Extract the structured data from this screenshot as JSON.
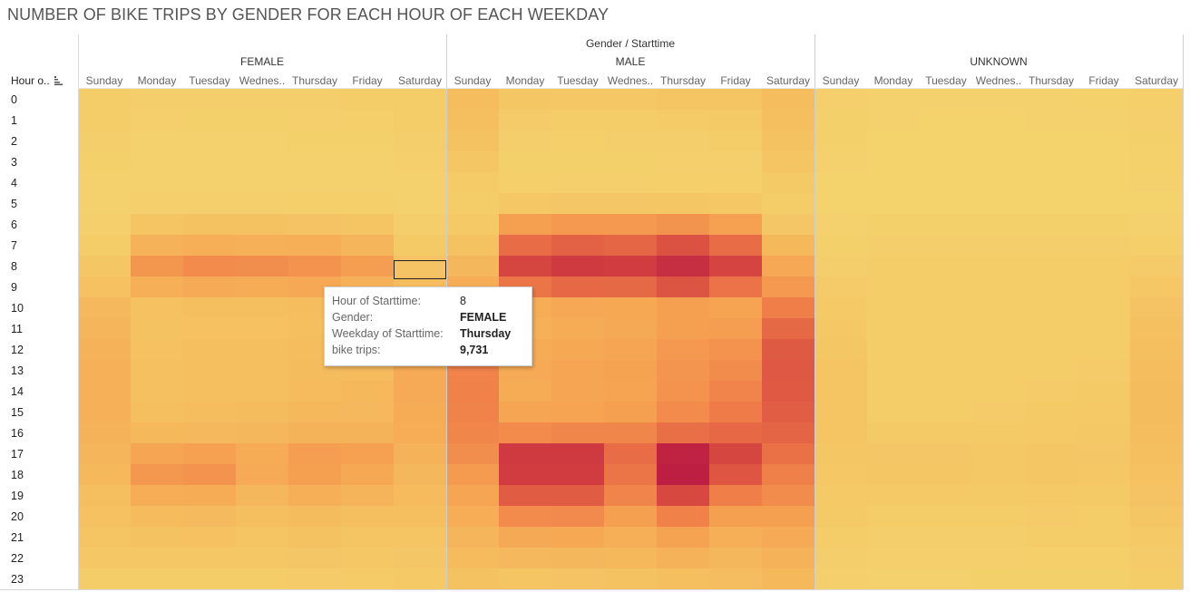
{
  "title": "NUMBER OF BIKE TRIPS BY GENDER FOR EACH HOUR OF EACH WEEKDAY",
  "header": {
    "top_label": "Gender / Starttime",
    "row_header": "Hour o..",
    "sort_icon": "sort-descending-icon"
  },
  "colors": {
    "low": "#f4d36d",
    "high": "#bc1f41",
    "grid_line": "#d9d9d9"
  },
  "tooltip": {
    "rows": [
      {
        "label": "Hour of Starttime:",
        "value": "8"
      },
      {
        "label": "Gender:",
        "value": "FEMALE"
      },
      {
        "label": "Weekday of Starttime:",
        "value": "Thursday"
      },
      {
        "label": "bike trips:",
        "value": "9,731"
      }
    ]
  },
  "chart_data": {
    "type": "heatmap",
    "title": "NUMBER OF BIKE TRIPS BY GENDER FOR EACH HOUR OF EACH WEEKDAY",
    "groups": [
      "FEMALE",
      "MALE",
      "UNKNOWN"
    ],
    "columns": [
      "Sunday",
      "Monday",
      "Tuesday",
      "Wednes..",
      "Thursday",
      "Friday",
      "Saturday"
    ],
    "rows": [
      "0",
      "1",
      "2",
      "3",
      "4",
      "5",
      "6",
      "7",
      "8",
      "9",
      "10",
      "11",
      "12",
      "13",
      "14",
      "15",
      "16",
      "17",
      "18",
      "19",
      "20",
      "21",
      "22",
      "23"
    ],
    "value_max": 20000,
    "values": {
      "FEMALE": [
        [
          1400,
          1000,
          900,
          900,
          1000,
          1100,
          1400
        ],
        [
          1200,
          700,
          600,
          600,
          700,
          800,
          1300
        ],
        [
          900,
          400,
          400,
          400,
          500,
          500,
          1000
        ],
        [
          600,
          300,
          300,
          300,
          300,
          300,
          700
        ],
        [
          400,
          300,
          300,
          300,
          300,
          300,
          400
        ],
        [
          400,
          700,
          700,
          700,
          800,
          800,
          400
        ],
        [
          700,
          2800,
          3200,
          3200,
          3000,
          2600,
          900
        ],
        [
          1300,
          6000,
          6600,
          6300,
          6500,
          5500,
          1800
        ],
        [
          2500,
          9500,
          10500,
          10200,
          9731,
          8800,
          3000
        ],
        [
          3500,
          6500,
          7200,
          7000,
          7500,
          6300,
          4200
        ],
        [
          5000,
          3500,
          4000,
          4000,
          4200,
          4000,
          5500
        ],
        [
          5500,
          3200,
          3500,
          3500,
          3800,
          4000,
          6500
        ],
        [
          6000,
          3500,
          3800,
          3800,
          4200,
          4200,
          7000
        ],
        [
          6200,
          3600,
          3900,
          3900,
          4300,
          4500,
          7200
        ],
        [
          6300,
          3600,
          3900,
          4000,
          4500,
          4800,
          7200
        ],
        [
          6200,
          3800,
          4200,
          4300,
          4800,
          5000,
          7000
        ],
        [
          6000,
          4800,
          5000,
          5200,
          5700,
          5800,
          6700
        ],
        [
          5500,
          8000,
          8400,
          7000,
          8800,
          8400,
          6000
        ],
        [
          4800,
          9400,
          9800,
          7200,
          8600,
          7600,
          5200
        ],
        [
          4000,
          6800,
          7000,
          5200,
          6400,
          5600,
          4500
        ],
        [
          3500,
          4500,
          4600,
          3900,
          4400,
          3800,
          3800
        ],
        [
          2800,
          3300,
          3400,
          2900,
          3300,
          2900,
          2900
        ],
        [
          2200,
          2200,
          2300,
          2200,
          2400,
          2200,
          2400
        ],
        [
          1400,
          1200,
          1300,
          1300,
          1500,
          1600,
          1900
        ]
      ],
      "MALE": [
        [
          4200,
          2500,
          2200,
          2200,
          2600,
          2900,
          4200
        ],
        [
          3800,
          1500,
          1300,
          1300,
          1600,
          1800,
          3800
        ],
        [
          3300,
          900,
          800,
          900,
          1000,
          1100,
          3300
        ],
        [
          2500,
          600,
          600,
          600,
          700,
          700,
          2600
        ],
        [
          1600,
          800,
          700,
          700,
          800,
          800,
          1800
        ],
        [
          1200,
          2200,
          2400,
          2400,
          2500,
          2300,
          1300
        ],
        [
          1900,
          8500,
          9200,
          9200,
          9700,
          8400,
          2400
        ],
        [
          3300,
          13200,
          14000,
          13600,
          15200,
          13200,
          4800
        ],
        [
          5200,
          16000,
          17200,
          17000,
          18500,
          16200,
          7500
        ],
        [
          6800,
          12500,
          13500,
          13400,
          15000,
          12700,
          9200
        ],
        [
          9000,
          6800,
          7500,
          7600,
          8500,
          8200,
          11800
        ],
        [
          10000,
          6300,
          7000,
          7300,
          8500,
          8800,
          13400
        ],
        [
          11000,
          7000,
          7600,
          8000,
          9200,
          9800,
          14500
        ],
        [
          11400,
          7200,
          7800,
          8300,
          9600,
          10400,
          14700
        ],
        [
          11500,
          7100,
          7800,
          8200,
          9800,
          11200,
          14600
        ],
        [
          11300,
          7800,
          8200,
          8600,
          10500,
          12000,
          14300
        ],
        [
          11000,
          10500,
          11000,
          11000,
          13000,
          13500,
          13700
        ],
        [
          10200,
          17200,
          17200,
          13200,
          19600,
          16000,
          12800
        ],
        [
          9000,
          17000,
          17000,
          12500,
          20000,
          14800,
          11600
        ],
        [
          7800,
          14400,
          14400,
          11200,
          15800,
          11800,
          10400
        ],
        [
          6800,
          10500,
          10600,
          8500,
          11500,
          8600,
          8500
        ],
        [
          5500,
          7400,
          7600,
          6500,
          8300,
          6600,
          7200
        ],
        [
          4500,
          5000,
          5200,
          4800,
          6000,
          5200,
          6000
        ],
        [
          3200,
          2700,
          3000,
          3300,
          4000,
          4100,
          4800
        ]
      ],
      "UNKNOWN": [
        [
          700,
          400,
          350,
          350,
          400,
          450,
          800
        ],
        [
          600,
          300,
          250,
          250,
          300,
          300,
          700
        ],
        [
          500,
          200,
          200,
          200,
          200,
          200,
          600
        ],
        [
          400,
          150,
          150,
          150,
          150,
          150,
          450
        ],
        [
          250,
          150,
          150,
          150,
          150,
          150,
          300
        ],
        [
          200,
          200,
          200,
          200,
          200,
          200,
          250
        ],
        [
          300,
          500,
          500,
          500,
          500,
          500,
          400
        ],
        [
          600,
          900,
          900,
          900,
          900,
          900,
          800
        ],
        [
          1000,
          1400,
          1400,
          1400,
          1300,
          1300,
          1500
        ],
        [
          1500,
          1300,
          1300,
          1300,
          1300,
          1300,
          2200
        ],
        [
          2000,
          1100,
          1100,
          1100,
          1200,
          1200,
          3000
        ],
        [
          2300,
          1100,
          1100,
          1100,
          1200,
          1300,
          3700
        ],
        [
          2500,
          1200,
          1200,
          1200,
          1300,
          1400,
          4000
        ],
        [
          2700,
          1200,
          1200,
          1300,
          1400,
          1500,
          4200
        ],
        [
          2800,
          1300,
          1300,
          1300,
          1500,
          1700,
          4300
        ],
        [
          2800,
          1400,
          1400,
          1500,
          1700,
          1900,
          4300
        ],
        [
          2700,
          1700,
          1700,
          1700,
          2000,
          2100,
          4200
        ],
        [
          2500,
          2400,
          2400,
          2100,
          2500,
          2400,
          3800
        ],
        [
          2300,
          2500,
          2500,
          2100,
          2500,
          2200,
          3500
        ],
        [
          2000,
          2000,
          2000,
          1700,
          2000,
          1800,
          3000
        ],
        [
          1700,
          1400,
          1400,
          1300,
          1500,
          1400,
          2500
        ],
        [
          1300,
          1000,
          1000,
          1000,
          1100,
          1100,
          2000
        ],
        [
          1000,
          700,
          700,
          700,
          800,
          800,
          1500
        ],
        [
          700,
          400,
          400,
          500,
          500,
          600,
          1100
        ]
      ]
    }
  }
}
